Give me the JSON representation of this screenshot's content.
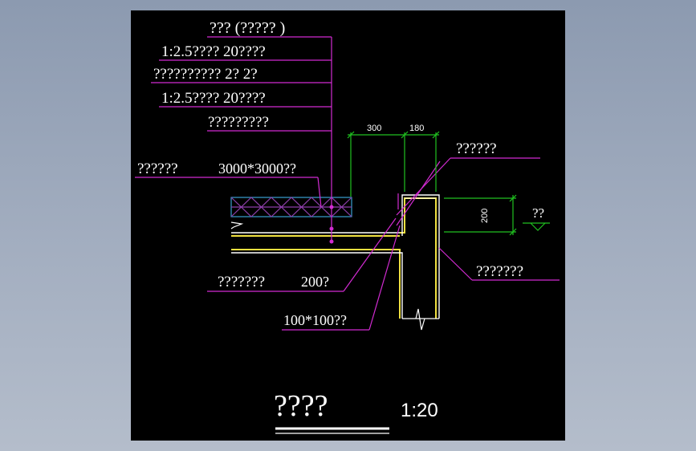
{
  "labels": {
    "waterproof_layer_title": "??? (????? )",
    "cement_mortar_1": "1:2.5????  20????",
    "waterproof_membrane": "??????????    2? 2?",
    "cement_mortar_2": "1:2.5????  20????",
    "roof_slab_layer": "?????????",
    "insulation_note_prefix": "??????",
    "insulation_note_dims": "3000*3000??",
    "top_right_note": "??????",
    "right_note": "???????",
    "slab_note_prefix": "???????",
    "slab_note_value": "200?",
    "chamfer_note": "100*100??",
    "elevation_label": "??",
    "detail_title": "????",
    "scale": "1:20"
  },
  "dimensions": {
    "width_1": "300",
    "width_2": "180",
    "height_1": "200"
  },
  "colors": {
    "background": "#000000",
    "leader_lines": "#d12bd1",
    "dimension_lines": "#20c020",
    "concrete_outline": "#ffffff",
    "structure_edge": "#f0e040",
    "insulation_hatch": "#8c3ea8",
    "insulation_border": "#3aa0d0",
    "text": "#ffffff"
  }
}
